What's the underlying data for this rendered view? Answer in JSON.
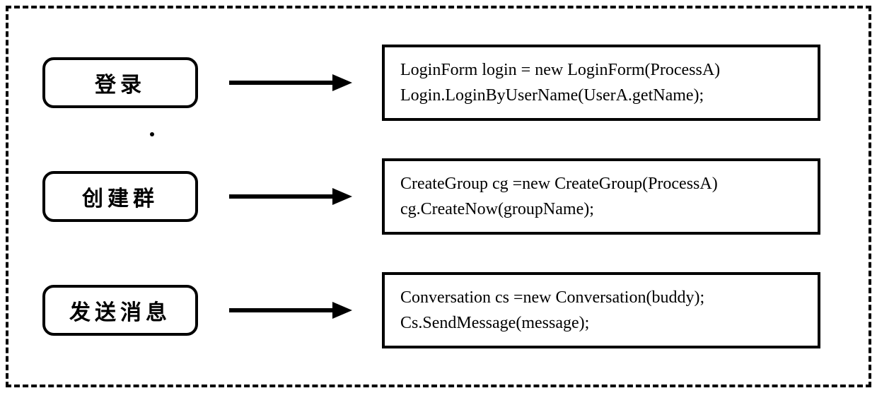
{
  "rows": [
    {
      "label": "登录",
      "code1": "LoginForm login = new LoginForm(ProcessA)",
      "code2": "Login.LoginByUserName(UserA.getName);"
    },
    {
      "label": "创建群",
      "code1": "CreateGroup cg =new CreateGroup(ProcessA)",
      "code2": "cg.CreateNow(groupName);"
    },
    {
      "label": "发送消息",
      "code1": "Conversation cs =new Conversation(buddy);",
      "code2": "Cs.SendMessage(message);"
    }
  ]
}
